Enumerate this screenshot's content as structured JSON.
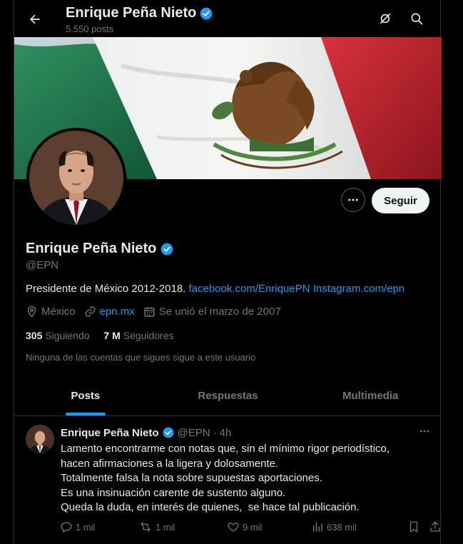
{
  "header": {
    "name": "Enrique Peña Nieto",
    "posts_count": "5.550 posts"
  },
  "profile": {
    "name": "Enrique Peña Nieto",
    "handle": "@EPN",
    "bio_text": "Presidente de México 2012-2018.",
    "bio_link1": "facebook.com/EnriquePN",
    "bio_link2": "Instagram.com/epn",
    "location": "México",
    "website": "epn.mx",
    "joined": "Se unió el marzo de 2007",
    "following_count": "305",
    "following_label": "Siguiendo",
    "followers_count": "7 M",
    "followers_label": "Seguidores",
    "followed_by_note": "Ninguna de las cuentas que sigues sigue a este usuario",
    "follow_button": "Seguir"
  },
  "tabs": [
    {
      "label": "Posts",
      "active": true
    },
    {
      "label": "Respuestas",
      "active": false
    },
    {
      "label": "Multimedia",
      "active": false
    }
  ],
  "tweet": {
    "author": "Enrique Peña Nieto",
    "handle": "@EPN",
    "separator": "·",
    "time": "4h",
    "lines": [
      "Lamento encontrarme con notas que, sin el mínimo rigor periodístico,",
      "hacen afirmaciones a la ligera y dolosamente.",
      "Totalmente falsa la nota sobre supuestas aportaciones.",
      "Es una insinuación carente de sustento alguno.",
      "Queda la duda, en interés de quienes,  se hace tal publicación."
    ],
    "replies": "1 mil",
    "reposts": "1 mil",
    "likes": "9 mil",
    "views": "638 mil"
  },
  "colors": {
    "background": "#000000",
    "accent": "#1d9bf0",
    "text_primary": "#e7e9ea",
    "text_secondary": "#71767b",
    "border": "#2f3336"
  },
  "icons": [
    "back-arrow-icon",
    "verified-badge-icon",
    "grok-icon",
    "search-icon",
    "more-icon",
    "location-icon",
    "link-icon",
    "calendar-icon",
    "reply-icon",
    "repost-icon",
    "like-icon",
    "views-icon",
    "bookmark-icon",
    "share-icon"
  ]
}
